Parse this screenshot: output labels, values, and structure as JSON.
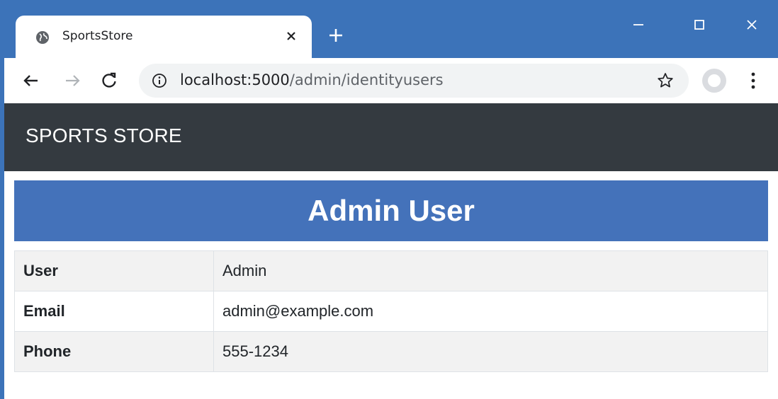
{
  "browser": {
    "tab_title": "SportsStore",
    "url_host": "localhost:5000",
    "url_path": "/admin/identityusers",
    "icons": {
      "tab": "globe-icon",
      "tab_close": "close-icon",
      "new_tab": "plus-icon",
      "minimize": "minimize-icon",
      "maximize": "maximize-icon",
      "close": "close-icon",
      "back": "arrow-left-icon",
      "forward": "arrow-right-icon",
      "reload": "reload-icon",
      "info": "info-icon",
      "bookmark": "star-icon",
      "profile": "avatar-icon",
      "menu": "kebab-menu-icon"
    },
    "colors": {
      "frame": "#3c73b9"
    }
  },
  "page": {
    "brand": "SPORTS STORE",
    "heading": "Admin User",
    "colors": {
      "navbar": "#343a40",
      "heading_bg": "#4472ba"
    },
    "details": [
      {
        "label": "User",
        "value": "Admin"
      },
      {
        "label": "Email",
        "value": "admin@example.com"
      },
      {
        "label": "Phone",
        "value": "555-1234"
      }
    ]
  }
}
